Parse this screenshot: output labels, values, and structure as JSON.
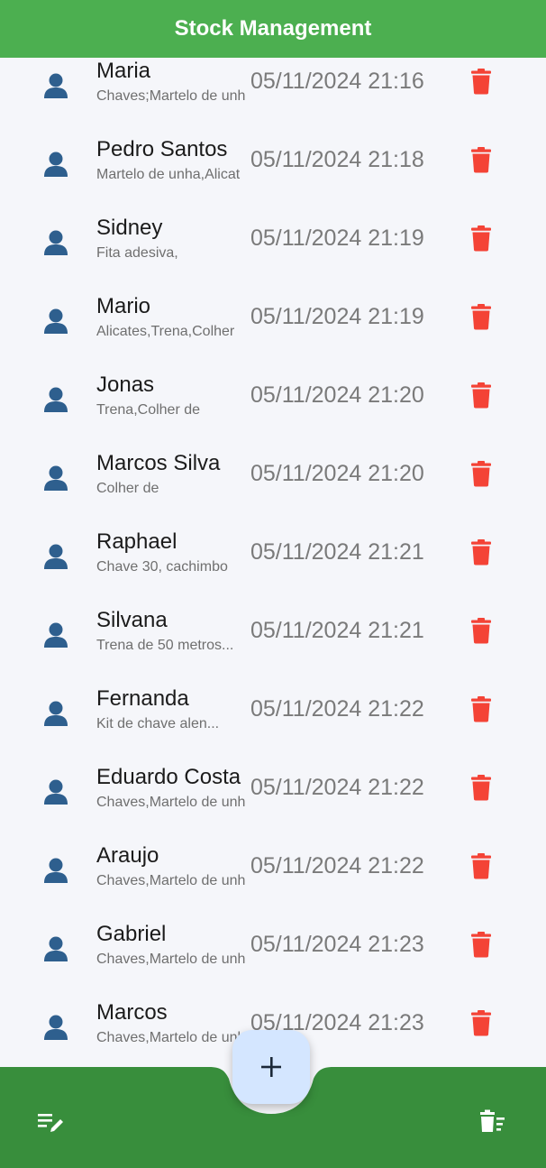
{
  "app": {
    "title": "Stock Management"
  },
  "colors": {
    "appbar": "#4caf50",
    "bottom_bar": "#388e3c",
    "avatar": "#2e5f8e",
    "delete": "#f44336",
    "fab": "#d4e6ff"
  },
  "icons": {
    "avatar": "person-icon",
    "delete": "trash-icon",
    "fab": "plus-icon",
    "left_action": "edit-list-icon",
    "right_action": "clear-all-icon"
  },
  "records": [
    {
      "name": "Maria",
      "items": "Chaves;Martelo de unh",
      "date": "05/11/2024 21:16"
    },
    {
      "name": "Pedro Santos",
      "items": "Martelo de unha,Alicat",
      "date": "05/11/2024 21:18"
    },
    {
      "name": "Sidney",
      "items": "Fita adesiva,",
      "date": "05/11/2024 21:19"
    },
    {
      "name": "Mario",
      "items": "Alicates,Trena,Colher",
      "date": "05/11/2024 21:19"
    },
    {
      "name": "Jonas",
      "items": "Trena,Colher de",
      "date": "05/11/2024 21:20"
    },
    {
      "name": "Marcos Silva",
      "items": "Colher de",
      "date": "05/11/2024 21:20"
    },
    {
      "name": "Raphael",
      "items": "Chave 30, cachimbo",
      "date": "05/11/2024 21:21"
    },
    {
      "name": "Silvana",
      "items": "Trena de 50 metros...",
      "date": "05/11/2024 21:21"
    },
    {
      "name": "Fernanda",
      "items": "Kit de chave alen...",
      "date": "05/11/2024 21:22"
    },
    {
      "name": "Eduardo Costa",
      "items": "Chaves,Martelo de unh",
      "date": "05/11/2024 21:22"
    },
    {
      "name": "Araujo",
      "items": "Chaves,Martelo de unh",
      "date": "05/11/2024 21:22"
    },
    {
      "name": "Gabriel",
      "items": "Chaves,Martelo de unh",
      "date": "05/11/2024 21:23"
    },
    {
      "name": "Marcos",
      "items": "Chaves,Martelo de unh",
      "date": "05/11/2024 21:23"
    }
  ]
}
